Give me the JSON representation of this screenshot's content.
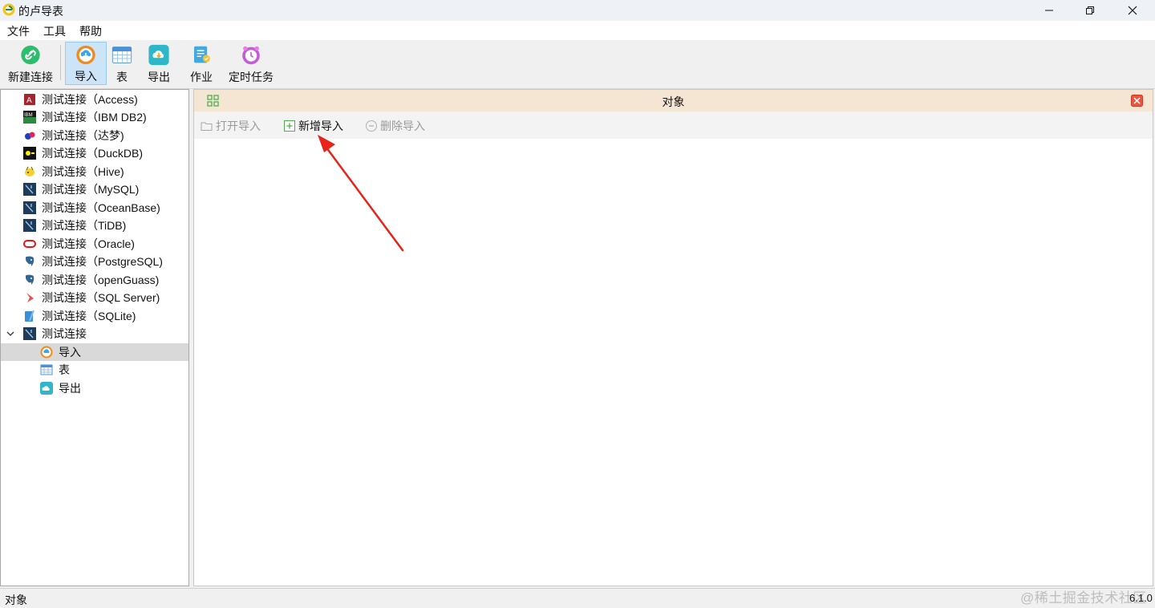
{
  "window": {
    "title": "的卢导表",
    "icon": "app-logo-icon",
    "controls": [
      "minimize-icon",
      "restore-icon",
      "close-icon"
    ]
  },
  "menu": {
    "items": [
      "文件",
      "工具",
      "帮助"
    ]
  },
  "toolbar": {
    "buttons": [
      {
        "label": "新建连接",
        "icon": "link-icon"
      },
      {
        "label": "导入",
        "icon": "import-icon",
        "active": true
      },
      {
        "label": "表",
        "icon": "table-icon"
      },
      {
        "label": "导出",
        "icon": "export-icon"
      },
      {
        "label": "作业",
        "icon": "job-icon"
      },
      {
        "label": "定时任务",
        "icon": "schedule-icon"
      }
    ]
  },
  "tree": {
    "connections": [
      {
        "label": "测试连接（Access)",
        "icon": "access-icon"
      },
      {
        "label": "测试连接（IBM DB2)",
        "icon": "ibm-db2-icon"
      },
      {
        "label": "测试连接（达梦)",
        "icon": "dameng-icon"
      },
      {
        "label": "测试连接（DuckDB)",
        "icon": "duckdb-icon"
      },
      {
        "label": "测试连接（Hive)",
        "icon": "hive-icon"
      },
      {
        "label": "测试连接（MySQL)",
        "icon": "mysql-icon"
      },
      {
        "label": "测试连接（OceanBase)",
        "icon": "oceanbase-icon"
      },
      {
        "label": "测试连接（TiDB)",
        "icon": "tidb-icon"
      },
      {
        "label": "测试连接（Oracle)",
        "icon": "oracle-icon"
      },
      {
        "label": "测试连接（PostgreSQL)",
        "icon": "postgresql-icon"
      },
      {
        "label": "测试连接（openGuass)",
        "icon": "openguass-icon"
      },
      {
        "label": "测试连接（SQL Server)",
        "icon": "sqlserver-icon"
      },
      {
        "label": "测试连接（SQLite)",
        "icon": "sqlite-icon"
      },
      {
        "label": "测试连接",
        "icon": "mysql-icon",
        "expanded": true
      }
    ],
    "children": [
      {
        "label": "导入",
        "icon": "import-icon",
        "selected": true
      },
      {
        "label": "表",
        "icon": "table-icon"
      },
      {
        "label": "导出",
        "icon": "export-icon"
      }
    ]
  },
  "panel": {
    "title": "对象",
    "actions": [
      {
        "label": "打开导入",
        "icon": "folder-open-icon",
        "enabled": false
      },
      {
        "label": "新增导入",
        "icon": "add-icon",
        "enabled": true
      },
      {
        "label": "删除导入",
        "icon": "remove-icon",
        "enabled": false
      }
    ]
  },
  "status": {
    "text": "对象",
    "watermark": "@稀土掘金技术社区",
    "version": "6.1.0"
  },
  "colors": {
    "accent": "#e8231a",
    "panel_header": "#f5e6d3",
    "selected_row": "#d9d9d9"
  }
}
